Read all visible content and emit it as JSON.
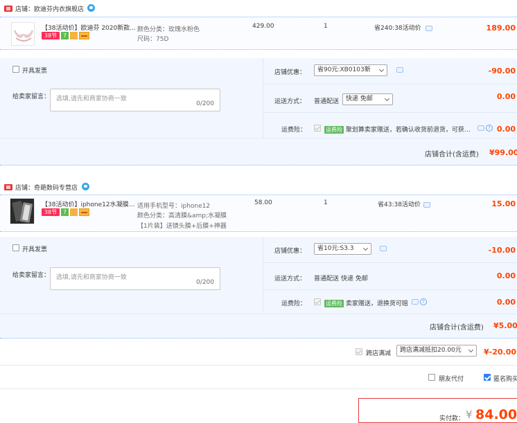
{
  "shops": [
    {
      "name": "店铺：欧迪芬内衣旗舰店",
      "item": {
        "title": "【38活动价】欧迪芬 2020新款…",
        "badge_38": "38节",
        "badge_7": "7",
        "sku_lines": [
          "颜色分类：玫瑰水粉色",
          "尺码：75D"
        ],
        "price": "429.00",
        "qty": "1",
        "promo": "省240:38活动价",
        "subtotal": "189.00"
      },
      "invoice_label": "开具发票",
      "message_label": "给卖家留言：",
      "message_placeholder": "选填,请先和商家协商一致",
      "message_count": "0/200",
      "discount_label": "店铺优惠：",
      "discount_select": "省90元:XB0103新",
      "discount_amount": "-90.00",
      "shipping_label": "运送方式：",
      "shipping_type": "普通配送",
      "shipping_select": "快递 免邮",
      "shipping_amount": "0.00",
      "insurance_label": "运费险：",
      "insurance_tag": "运费险",
      "insurance_text": "聚划算卖家赠送，若确认收货前退货，可获…",
      "insurance_amount": "0.00",
      "total_label": "店铺合计(含运费)",
      "total_amount": "¥99.00"
    },
    {
      "name": "店铺：奇葩数码专营店",
      "item": {
        "title": "【38活动价】iphone12水凝膜…",
        "badge_38": "38节",
        "badge_7": "7",
        "sku_lines": [
          "适用手机型号：iphone12",
          "颜色分类：高清膜&amp;水凝膜",
          "【1片装】送镜头膜+后膜+神器"
        ],
        "price": "58.00",
        "qty": "1",
        "promo": "省43:38活动价",
        "subtotal": "15.00"
      },
      "invoice_label": "开具发票",
      "message_label": "给卖家留言：",
      "message_placeholder": "选填,请先和商家协商一致",
      "message_count": "0/200",
      "discount_label": "店铺优惠：",
      "discount_select": "省10元:S3.3",
      "discount_amount": "-10.00",
      "shipping_label": "运送方式：",
      "shipping_type": "普通配送",
      "shipping_select": "快递 免邮",
      "shipping_amount": "0.00",
      "insurance_label": "运费险：",
      "insurance_tag": "运费险",
      "insurance_text": "卖家赠送，退换货可赔",
      "insurance_amount": "0.00",
      "total_label": "店铺合计(含运费)",
      "total_amount": "¥5.00"
    }
  ],
  "cross_store": {
    "label": "跨店满减",
    "select": "跨店满减抵扣20.00元",
    "amount": "¥-20.00"
  },
  "footer": {
    "friend_pay": "朋友代付",
    "anonymous": "匿名购买"
  },
  "pay": {
    "label": "实付款：",
    "currency": "¥",
    "amount": "84.00"
  },
  "colors": {
    "accent_red": "#ff4400",
    "link_blue": "#80b2ff",
    "panel_bg": "#f2f7ff"
  }
}
